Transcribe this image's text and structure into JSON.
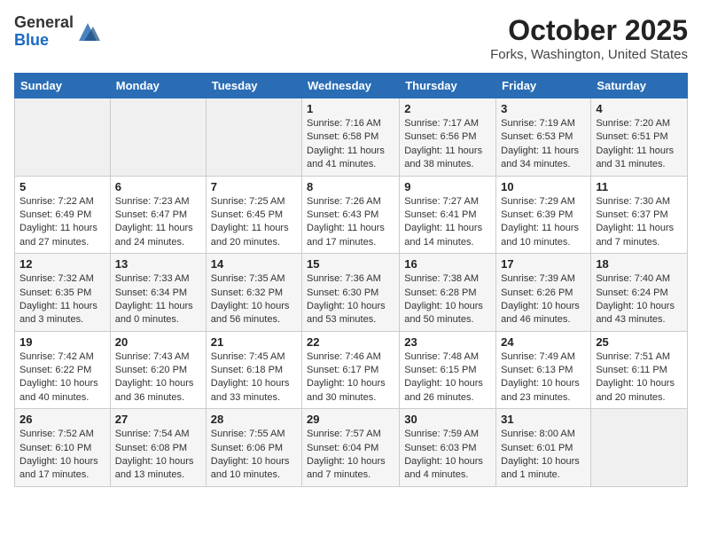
{
  "logo": {
    "general": "General",
    "blue": "Blue"
  },
  "title": "October 2025",
  "location": "Forks, Washington, United States",
  "days_of_week": [
    "Sunday",
    "Monday",
    "Tuesday",
    "Wednesday",
    "Thursday",
    "Friday",
    "Saturday"
  ],
  "weeks": [
    [
      {
        "day": "",
        "info": ""
      },
      {
        "day": "",
        "info": ""
      },
      {
        "day": "",
        "info": ""
      },
      {
        "day": "1",
        "info": "Sunrise: 7:16 AM\nSunset: 6:58 PM\nDaylight: 11 hours and 41 minutes."
      },
      {
        "day": "2",
        "info": "Sunrise: 7:17 AM\nSunset: 6:56 PM\nDaylight: 11 hours and 38 minutes."
      },
      {
        "day": "3",
        "info": "Sunrise: 7:19 AM\nSunset: 6:53 PM\nDaylight: 11 hours and 34 minutes."
      },
      {
        "day": "4",
        "info": "Sunrise: 7:20 AM\nSunset: 6:51 PM\nDaylight: 11 hours and 31 minutes."
      }
    ],
    [
      {
        "day": "5",
        "info": "Sunrise: 7:22 AM\nSunset: 6:49 PM\nDaylight: 11 hours and 27 minutes."
      },
      {
        "day": "6",
        "info": "Sunrise: 7:23 AM\nSunset: 6:47 PM\nDaylight: 11 hours and 24 minutes."
      },
      {
        "day": "7",
        "info": "Sunrise: 7:25 AM\nSunset: 6:45 PM\nDaylight: 11 hours and 20 minutes."
      },
      {
        "day": "8",
        "info": "Sunrise: 7:26 AM\nSunset: 6:43 PM\nDaylight: 11 hours and 17 minutes."
      },
      {
        "day": "9",
        "info": "Sunrise: 7:27 AM\nSunset: 6:41 PM\nDaylight: 11 hours and 14 minutes."
      },
      {
        "day": "10",
        "info": "Sunrise: 7:29 AM\nSunset: 6:39 PM\nDaylight: 11 hours and 10 minutes."
      },
      {
        "day": "11",
        "info": "Sunrise: 7:30 AM\nSunset: 6:37 PM\nDaylight: 11 hours and 7 minutes."
      }
    ],
    [
      {
        "day": "12",
        "info": "Sunrise: 7:32 AM\nSunset: 6:35 PM\nDaylight: 11 hours and 3 minutes."
      },
      {
        "day": "13",
        "info": "Sunrise: 7:33 AM\nSunset: 6:34 PM\nDaylight: 11 hours and 0 minutes."
      },
      {
        "day": "14",
        "info": "Sunrise: 7:35 AM\nSunset: 6:32 PM\nDaylight: 10 hours and 56 minutes."
      },
      {
        "day": "15",
        "info": "Sunrise: 7:36 AM\nSunset: 6:30 PM\nDaylight: 10 hours and 53 minutes."
      },
      {
        "day": "16",
        "info": "Sunrise: 7:38 AM\nSunset: 6:28 PM\nDaylight: 10 hours and 50 minutes."
      },
      {
        "day": "17",
        "info": "Sunrise: 7:39 AM\nSunset: 6:26 PM\nDaylight: 10 hours and 46 minutes."
      },
      {
        "day": "18",
        "info": "Sunrise: 7:40 AM\nSunset: 6:24 PM\nDaylight: 10 hours and 43 minutes."
      }
    ],
    [
      {
        "day": "19",
        "info": "Sunrise: 7:42 AM\nSunset: 6:22 PM\nDaylight: 10 hours and 40 minutes."
      },
      {
        "day": "20",
        "info": "Sunrise: 7:43 AM\nSunset: 6:20 PM\nDaylight: 10 hours and 36 minutes."
      },
      {
        "day": "21",
        "info": "Sunrise: 7:45 AM\nSunset: 6:18 PM\nDaylight: 10 hours and 33 minutes."
      },
      {
        "day": "22",
        "info": "Sunrise: 7:46 AM\nSunset: 6:17 PM\nDaylight: 10 hours and 30 minutes."
      },
      {
        "day": "23",
        "info": "Sunrise: 7:48 AM\nSunset: 6:15 PM\nDaylight: 10 hours and 26 minutes."
      },
      {
        "day": "24",
        "info": "Sunrise: 7:49 AM\nSunset: 6:13 PM\nDaylight: 10 hours and 23 minutes."
      },
      {
        "day": "25",
        "info": "Sunrise: 7:51 AM\nSunset: 6:11 PM\nDaylight: 10 hours and 20 minutes."
      }
    ],
    [
      {
        "day": "26",
        "info": "Sunrise: 7:52 AM\nSunset: 6:10 PM\nDaylight: 10 hours and 17 minutes."
      },
      {
        "day": "27",
        "info": "Sunrise: 7:54 AM\nSunset: 6:08 PM\nDaylight: 10 hours and 13 minutes."
      },
      {
        "day": "28",
        "info": "Sunrise: 7:55 AM\nSunset: 6:06 PM\nDaylight: 10 hours and 10 minutes."
      },
      {
        "day": "29",
        "info": "Sunrise: 7:57 AM\nSunset: 6:04 PM\nDaylight: 10 hours and 7 minutes."
      },
      {
        "day": "30",
        "info": "Sunrise: 7:59 AM\nSunset: 6:03 PM\nDaylight: 10 hours and 4 minutes."
      },
      {
        "day": "31",
        "info": "Sunrise: 8:00 AM\nSunset: 6:01 PM\nDaylight: 10 hours and 1 minute."
      },
      {
        "day": "",
        "info": ""
      }
    ]
  ]
}
